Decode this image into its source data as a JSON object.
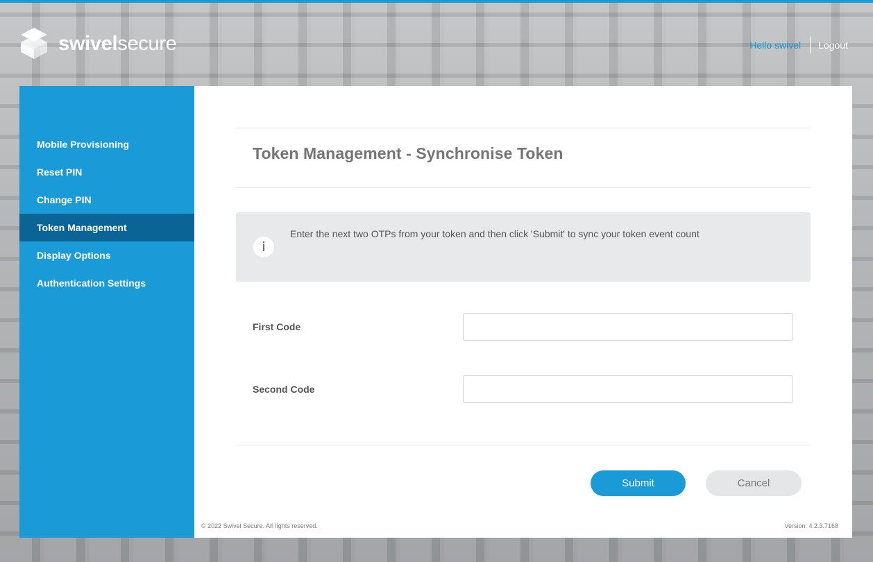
{
  "brand": {
    "name_bold": "swivel",
    "name_light": "secure",
    "logo_icon": "stacked-cubes-logo"
  },
  "header": {
    "greeting": "Hello swivel",
    "logout_label": "Logout"
  },
  "sidebar": {
    "items": [
      {
        "label": "Mobile Provisioning",
        "active": false
      },
      {
        "label": "Reset PIN",
        "active": false
      },
      {
        "label": "Change PIN",
        "active": false
      },
      {
        "label": "Token Management",
        "active": true
      },
      {
        "label": "Display Options",
        "active": false
      },
      {
        "label": "Authentication Settings",
        "active": false
      }
    ]
  },
  "main": {
    "title": "Token Management - Synchronise Token",
    "info": {
      "icon": "info-icon",
      "icon_glyph": "i",
      "text": "Enter the next two OTPs from your token and then click 'Submit' to sync your token event count"
    },
    "fields": [
      {
        "label": "First Code",
        "value": "",
        "placeholder": ""
      },
      {
        "label": "Second Code",
        "value": "",
        "placeholder": ""
      }
    ],
    "submit_label": "Submit",
    "cancel_label": "Cancel"
  },
  "footer": {
    "copyright": "© 2022 Swivel Secure. All rights reserved.",
    "version": "Version: 4.2.3.7168"
  },
  "colors": {
    "accent": "#1a9ad6",
    "active_nav": "#0a6596",
    "info_background": "#e8e9ea",
    "cancel_background": "#e5e6e7"
  }
}
